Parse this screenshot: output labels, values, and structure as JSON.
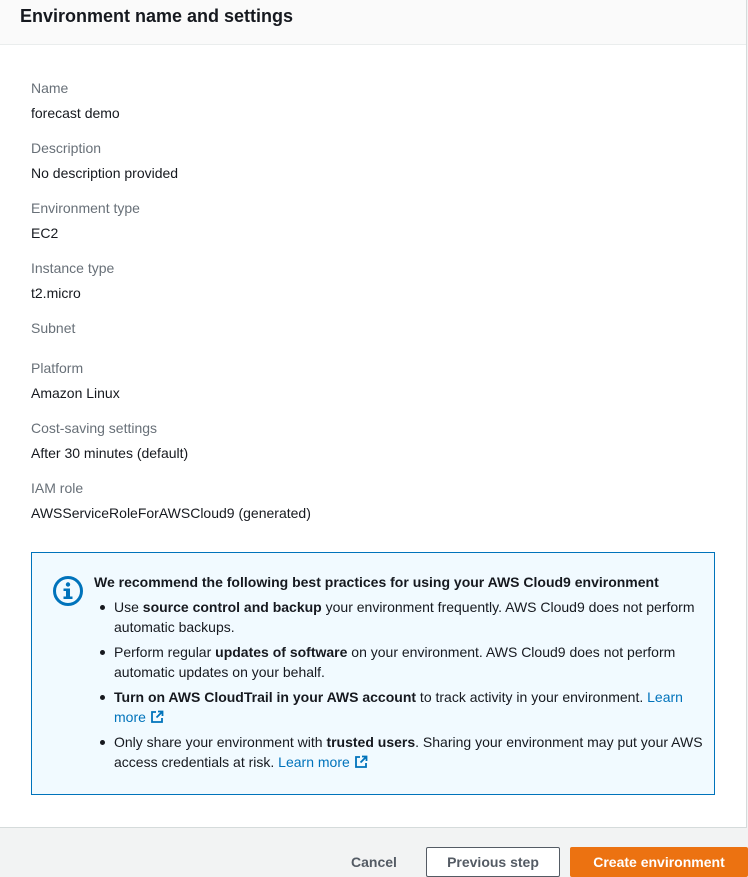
{
  "panel": {
    "title": "Environment name and settings",
    "fields": [
      {
        "label": "Name",
        "value": "forecast demo"
      },
      {
        "label": "Description",
        "value": "No description provided"
      },
      {
        "label": "Environment type",
        "value": "EC2"
      },
      {
        "label": "Instance type",
        "value": "t2.micro"
      },
      {
        "label": "Subnet",
        "value": ""
      },
      {
        "label": "Platform",
        "value": "Amazon Linux"
      },
      {
        "label": "Cost-saving settings",
        "value": "After 30 minutes (default)"
      },
      {
        "label": "IAM role",
        "value": "AWSServiceRoleForAWSCloud9 (generated)"
      }
    ]
  },
  "info": {
    "title": "We recommend the following best practices for using your AWS Cloud9 environment",
    "items": [
      {
        "pre": "Use ",
        "bold": "source control and backup",
        "post": " your environment frequently. AWS Cloud9 does not perform automatic backups.",
        "link": ""
      },
      {
        "pre": "Perform regular ",
        "bold": "updates of software",
        "post": " on your environment. AWS Cloud9 does not perform automatic updates on your behalf.",
        "link": ""
      },
      {
        "pre": "",
        "bold": "Turn on AWS CloudTrail in your AWS account",
        "post": " to track activity in your environment. ",
        "link": "Learn more"
      },
      {
        "pre": "Only share your environment with ",
        "bold": "trusted users",
        "post": ". Sharing your environment may put your AWS access credentials at risk. ",
        "link": "Learn more"
      }
    ]
  },
  "footer": {
    "cancel_label": "Cancel",
    "previous_label": "Previous step",
    "create_label": "Create environment"
  },
  "colors": {
    "accent": "#0073bb",
    "primary_button": "#ec7211"
  }
}
